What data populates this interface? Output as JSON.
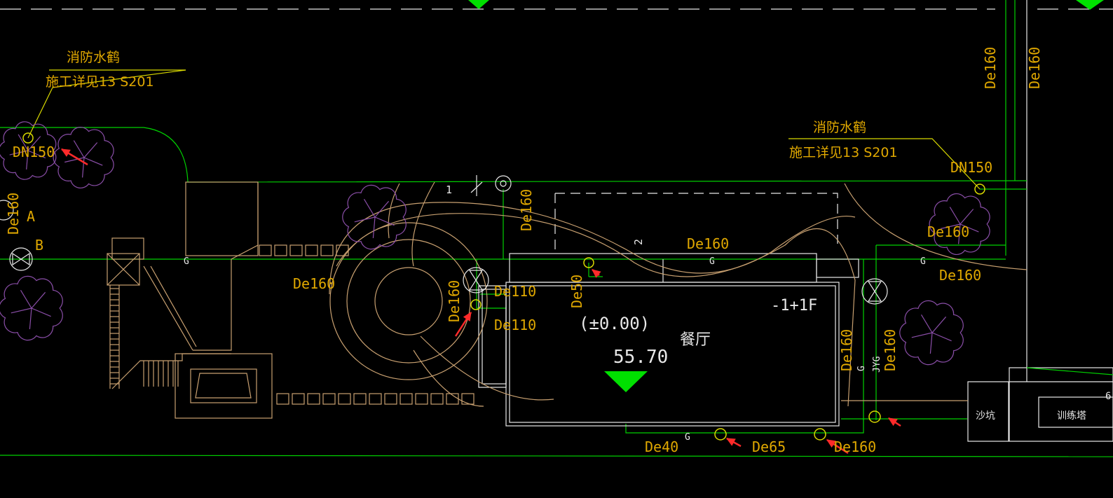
{
  "colors": {
    "background": "#000000",
    "pipe_green": "#00d000",
    "text_gold": "#e0a800",
    "leader_yellow": "#d9d900",
    "outline_tan": "#c8a070",
    "outline_white": "#e8e8e8",
    "tree_purple": "#8a4ea8",
    "arrow_red": "#ff2a2a",
    "marker_green": "#00e000"
  },
  "hydrant_note_left": {
    "title": "消防水鹤",
    "detail": "施工详见13 S201",
    "size": "DN150"
  },
  "hydrant_note_right": {
    "title": "消防水鹤",
    "detail": "施工详见13 S201",
    "size": "DN150"
  },
  "axis_labels": {
    "a": "A",
    "b": "B"
  },
  "pipe_labels": {
    "left_vertical": "De160",
    "left_run": "De160",
    "upper_vertical": "De160",
    "building_top": "De160",
    "building_left": "De160",
    "branch_upper": "De110",
    "branch_lower": "De110",
    "branch_de50": "De50",
    "right_top_1": "De160",
    "right_top_2": "De160",
    "right_mid": "De160",
    "right_mid_2": "De160",
    "right_vertical_1": "De160",
    "right_vertical_2": "De160",
    "bottom_de40": "De40",
    "bottom_de65": "De65",
    "bottom_de160": "De160"
  },
  "pipe_codes": {
    "g": "G",
    "jyg": "JYG"
  },
  "building": {
    "floors": "-1+1F",
    "name": "餐厅",
    "level_note": "(±0.00)",
    "elevation": "55.70"
  },
  "dim_labels": {
    "d1": "1",
    "d2": "2"
  },
  "facilities": {
    "sand_pit": "沙坑",
    "training_tower": "训练塔",
    "corner": "6"
  }
}
